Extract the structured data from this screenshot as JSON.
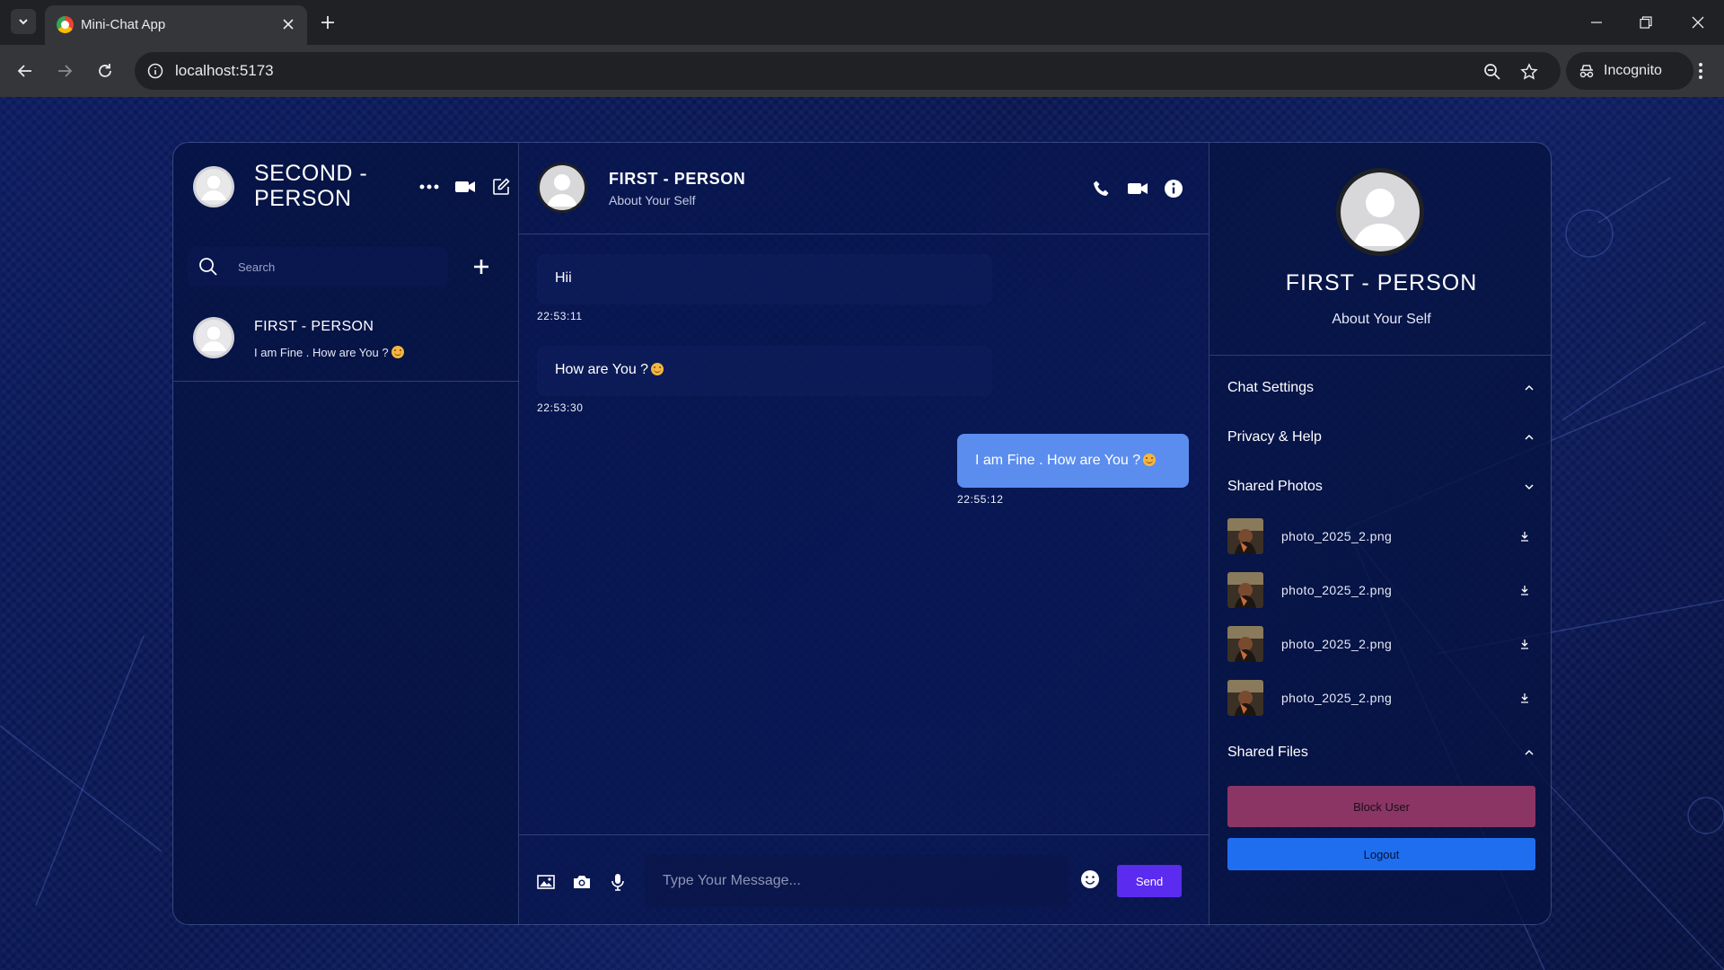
{
  "browser": {
    "tab_title": "Mini-Chat App",
    "url": "localhost:5173",
    "incognito_label": "Incognito"
  },
  "sidebar": {
    "user_name": "SECOND - PERSON",
    "search_placeholder": "Search",
    "contacts": [
      {
        "name": "FIRST - PERSON",
        "last_message": "I am Fine . How are You ?"
      }
    ]
  },
  "chat": {
    "header": {
      "name": "FIRST - PERSON",
      "status": "About Your Self"
    },
    "messages": [
      {
        "direction": "in",
        "text": "Hii",
        "time": "22:53:11"
      },
      {
        "direction": "in",
        "text": "How are You ?",
        "time": "22:53:30"
      },
      {
        "direction": "out",
        "text": "I am Fine . How are You ?",
        "time": "22:55:12"
      }
    ],
    "composer": {
      "placeholder": "Type Your Message...",
      "send_label": "Send"
    }
  },
  "details": {
    "name": "FIRST - PERSON",
    "status": "About Your Self",
    "sections": {
      "chat_settings": "Chat Settings",
      "privacy_help": "Privacy & Help",
      "shared_photos": "Shared Photos",
      "shared_files": "Shared Files"
    },
    "photos": [
      {
        "name": "photo_2025_2.png"
      },
      {
        "name": "photo_2025_2.png"
      },
      {
        "name": "photo_2025_2.png"
      },
      {
        "name": "photo_2025_2.png"
      }
    ],
    "block_label": "Block User",
    "logout_label": "Logout"
  },
  "colors": {
    "outgoing_bubble": "#5b8def",
    "send_button": "#5b2bf0",
    "block_button": "#8b3565",
    "logout_button": "#1f6ef0"
  }
}
